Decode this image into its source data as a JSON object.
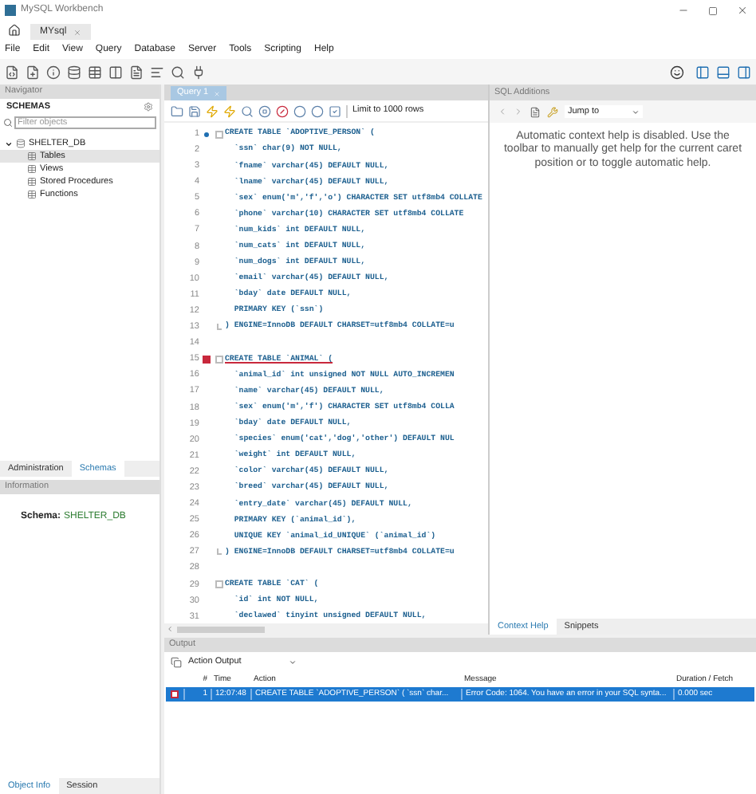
{
  "window": {
    "title": "MySQL Workbench"
  },
  "connection_tabs": [
    {
      "label": "MYsql",
      "selected": true
    }
  ],
  "menu": [
    "File",
    "Edit",
    "View",
    "Query",
    "Database",
    "Server",
    "Tools",
    "Scripting",
    "Help"
  ],
  "navigator": {
    "title": "Navigator",
    "section": "SCHEMAS",
    "filter": {
      "placeholder": "Filter objects"
    },
    "tree": [
      {
        "label": "SHELTER_DB",
        "expanded": true,
        "selected": false,
        "children": [
          {
            "label": "Tables",
            "selected": true
          },
          {
            "label": "Views",
            "selected": false
          },
          {
            "label": "Stored Procedures",
            "selected": false
          },
          {
            "label": "Functions",
            "selected": false
          }
        ]
      }
    ],
    "tabs": [
      {
        "label": "Administration",
        "selected": false
      },
      {
        "label": "Schemas",
        "selected": true
      }
    ],
    "info_title": "Information",
    "schema_label": "Schema:",
    "schema_value": "SHELTER_DB",
    "bottom_tabs": [
      {
        "label": "Object Info",
        "selected": true
      },
      {
        "label": "Session",
        "selected": false
      }
    ]
  },
  "editor": {
    "tabs": [
      {
        "label": "Query 1",
        "selected": true
      }
    ],
    "limit": "Limit to 1000 rows",
    "lines": [
      {
        "number": "1",
        "text": "CREATE TABLE `ADOPTIVE_PERSON` (",
        "current": true,
        "fold_start": true
      },
      {
        "number": "2",
        "text": "  `ssn` char(9) NOT NULL,"
      },
      {
        "number": "3",
        "text": "  `fname` varchar(45) DEFAULT NULL,"
      },
      {
        "number": "4",
        "text": "  `lname` varchar(45) DEFAULT NULL,"
      },
      {
        "number": "5",
        "text": "  `sex` enum('m','f','o') CHARACTER SET utf8mb4 COLLATE"
      },
      {
        "number": "6",
        "text": "  `phone` varchar(10) CHARACTER SET utf8mb4 COLLATE"
      },
      {
        "number": "7",
        "text": "  `num_kids` int DEFAULT NULL,"
      },
      {
        "number": "8",
        "text": "  `num_cats` int DEFAULT NULL,"
      },
      {
        "number": "9",
        "text": "  `num_dogs` int DEFAULT NULL,"
      },
      {
        "number": "10",
        "text": "  `email` varchar(45) DEFAULT NULL,"
      },
      {
        "number": "11",
        "text": "  `bday` date DEFAULT NULL,"
      },
      {
        "number": "12",
        "text": "  PRIMARY KEY (`ssn`)"
      },
      {
        "number": "13",
        "text": ") ENGINE=InnoDB DEFAULT CHARSET=utf8mb4 COLLATE=u",
        "fold_end": true
      },
      {
        "number": "14"
      },
      {
        "number": "15",
        "text": "CREATE TABLE `ANIMAL` (",
        "error": true,
        "fold_start": true
      },
      {
        "number": "16",
        "text": "  `animal_id` int unsigned NOT NULL AUTO_INCREMEN"
      },
      {
        "number": "17",
        "text": "  `name` varchar(45) DEFAULT NULL,"
      },
      {
        "number": "18",
        "text": "  `sex` enum('m','f') CHARACTER SET utf8mb4 COLLA"
      },
      {
        "number": "19",
        "text": "  `bday` date DEFAULT NULL,"
      },
      {
        "number": "20",
        "text": "  `species` enum('cat','dog','other') DEFAULT NUL"
      },
      {
        "number": "21",
        "text": "  `weight` int DEFAULT NULL,"
      },
      {
        "number": "22",
        "text": "  `color` varchar(45) DEFAULT NULL,"
      },
      {
        "number": "23",
        "text": "  `breed` varchar(45) DEFAULT NULL,"
      },
      {
        "number": "24",
        "text": "  `entry_date` varchar(45) DEFAULT NULL,"
      },
      {
        "number": "25",
        "text": "  PRIMARY KEY (`animal_id`),"
      },
      {
        "number": "26",
        "text": "  UNIQUE KEY `animal_id_UNIQUE` (`animal_id`)"
      },
      {
        "number": "27",
        "text": ") ENGINE=InnoDB DEFAULT CHARSET=utf8mb4 COLLATE=u",
        "fold_end": true
      },
      {
        "number": "28"
      },
      {
        "number": "29",
        "text": "CREATE TABLE `CAT` (",
        "fold_start": true
      },
      {
        "number": "30",
        "text": "  `id` int NOT NULL,"
      },
      {
        "number": "31",
        "text": "  `declawed` tinyint unsigned DEFAULT NULL,"
      }
    ]
  },
  "sql_additions": {
    "title": "SQL Additions",
    "jump_to": "Jump to",
    "help": "Automatic context help is disabled. Use the toolbar to manually get help for the current caret position or to toggle automatic help.",
    "tabs": [
      {
        "label": "Context Help",
        "selected": true
      },
      {
        "label": "Snippets",
        "selected": false
      }
    ]
  },
  "output": {
    "title": "Output",
    "mode": "Action Output",
    "columns": [
      "#",
      "Time",
      "Action",
      "Message",
      "Duration / Fetch"
    ],
    "rows": [
      {
        "error": true,
        "number": "1",
        "time": "12:07:48",
        "action": "CREATE TABLE `ADOPTIVE_PERSON` (  `ssn` char...",
        "message": "Error Code: 1064. You have an error in your SQL synta...",
        "duration": "0.000 sec",
        "selected": true
      }
    ]
  }
}
